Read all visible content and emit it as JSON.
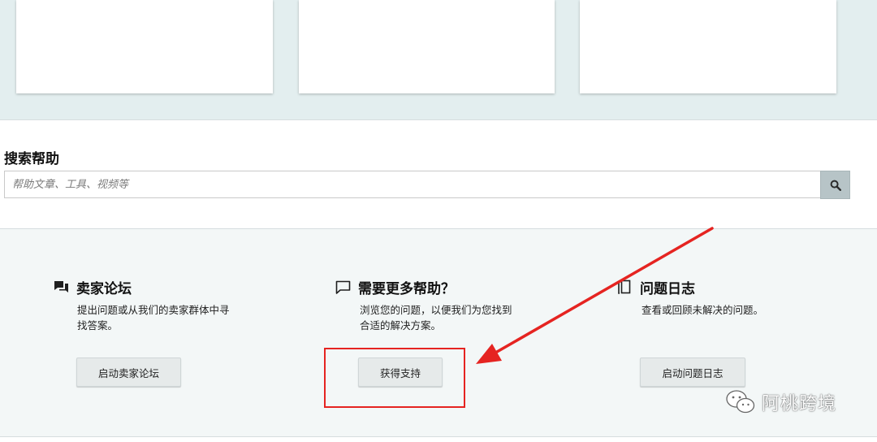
{
  "search": {
    "title": "搜索帮助",
    "placeholder": "帮助文章、工具、视频等",
    "button_icon": "search-icon"
  },
  "help": {
    "columns": [
      {
        "icon": "forum-icon",
        "title": "卖家论坛",
        "desc_line1": "提出问题或从我们的卖家群体中寻",
        "desc_line2": "找答案。",
        "button_label": "启动卖家论坛"
      },
      {
        "icon": "chat-bubble-icon",
        "title": "需要更多帮助？",
        "desc_line1": "浏览您的问题，以便我们为您找到",
        "desc_line2": "合适的解决方案。",
        "button_label": "获得支持"
      },
      {
        "icon": "case-log-icon",
        "title": "问题日志",
        "desc_line1": "查看或回顾未解决的问题。",
        "desc_line2": "",
        "button_label": "启动问题日志"
      }
    ]
  },
  "annotation": {
    "highlight_color": "#e52421"
  },
  "watermark": {
    "text": "阿桃跨境",
    "icon": "wechat-icon"
  },
  "colors": {
    "top_band": "#e3eeef",
    "panel": "#f3f7f7",
    "search_button": "#b7c4c7",
    "button": "#e6eaea"
  }
}
